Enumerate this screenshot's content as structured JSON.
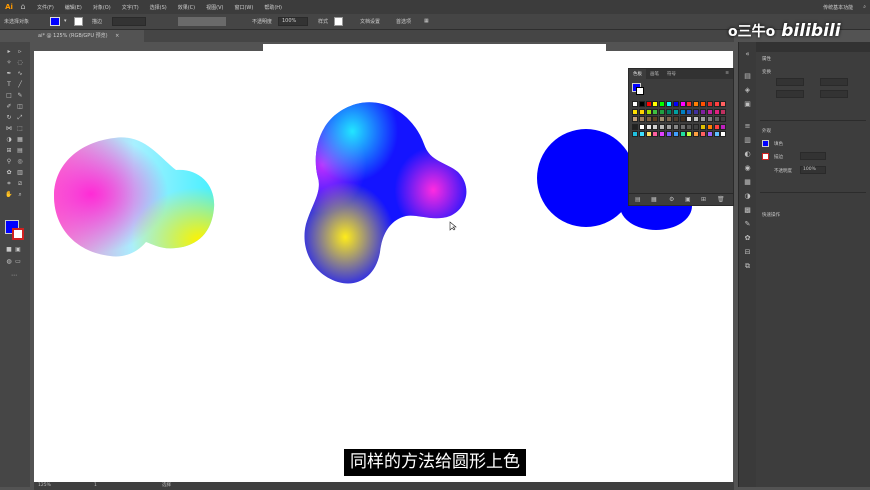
{
  "menubar": {
    "app_logo": "Ai",
    "home_icon": "home-icon",
    "items": [
      "文件(F)",
      "编辑(E)",
      "对象(O)",
      "文字(T)",
      "选择(S)",
      "效果(C)",
      "视图(V)",
      "窗口(W)",
      "帮助(H)"
    ],
    "workspace": "传统基本功能",
    "search_icon": "search-icon"
  },
  "controlbar": {
    "selection": "未选择对象",
    "stroke_label": "描边",
    "stroke_value": "",
    "opacity_label": "不透明度",
    "opacity_value": "100%",
    "style_label": "样式",
    "doc_setup": "文档设置",
    "preferences": "首选项"
  },
  "tabstrip": {
    "doc_tab": "ai* @ 125% (RGB/GPU 预览)",
    "close": "×"
  },
  "canvas": {
    "fill_color": "#0000ff"
  },
  "swatches_panel": {
    "tabs": [
      "色板",
      "画笔",
      "符号"
    ],
    "menu_icon": "panel-menu-icon"
  },
  "props_panel": {
    "title": "属性",
    "section_transform": "变换",
    "section_appearance": "外观",
    "fill_label": "填色",
    "stroke_label": "描边",
    "opacity_label": "不透明度",
    "opacity_value": "100%",
    "quick_actions": "快速操作"
  },
  "statusbar": {
    "zoom": "125%",
    "artboard": "1",
    "tool": "选择"
  },
  "watermark": {
    "channel": "o三牛o",
    "site": "bilibili"
  },
  "subtitle": {
    "text": "同样的方法给圆形上色"
  }
}
